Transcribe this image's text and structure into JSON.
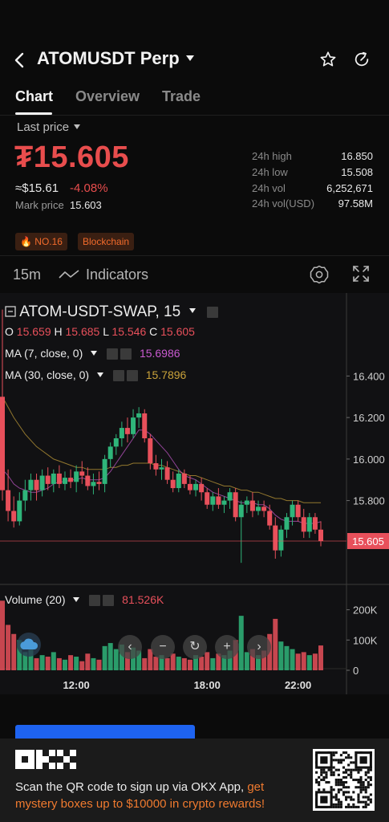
{
  "header": {
    "title": "ATOMUSDT Perp"
  },
  "tabs": [
    {
      "label": "Chart"
    },
    {
      "label": "Overview"
    },
    {
      "label": "Trade"
    }
  ],
  "price_panel": {
    "last_price_label": "Last price",
    "price": "₮15.605",
    "usd_price": "≈$15.61",
    "change_pct": "-4.08%",
    "mark_label": "Mark price",
    "mark_value": "15.603",
    "stats": [
      {
        "label": "24h high",
        "value": "16.850"
      },
      {
        "label": "24h low",
        "value": "15.508"
      },
      {
        "label": "24h vol",
        "value": "6,252,671"
      },
      {
        "label": "24h vol(USD)",
        "value": "97.58M"
      }
    ],
    "tags": [
      "NO.16",
      "Blockchain"
    ]
  },
  "chart_toolbar": {
    "interval": "15m",
    "indicators_label": "Indicators"
  },
  "chart_legend": {
    "symbol": "ATOM-USDT-SWAP, 15",
    "o_label": "O",
    "o_value": "15.659",
    "h_label": "H",
    "h_value": "15.685",
    "l_label": "L",
    "l_value": "15.546",
    "c_label": "C",
    "c_value": "15.605",
    "ma7_label": "MA (7, close, 0)",
    "ma7_value": "15.6986",
    "ma30_label": "MA (30, close, 0)",
    "ma30_value": "15.7896",
    "volume_label": "Volume (20)",
    "volume_value": "81.526K"
  },
  "colors": {
    "up": "#2fb57a",
    "down": "#e8505b",
    "ma7": "#c95ad0",
    "ma30": "#c9a23a",
    "accent_red": "#e84d4d",
    "accent_orange": "#f26b2b"
  },
  "chart_data": {
    "type": "candlestick",
    "current_price": 15.605,
    "price_axis": {
      "ticks": [
        "16.400",
        "16.200",
        "16.000",
        "15.800"
      ],
      "tick_values": [
        16.4,
        16.2,
        16.0,
        15.8
      ],
      "range": [
        15.4,
        16.8
      ]
    },
    "time_axis": {
      "ticks": [
        "12:00",
        "18:00",
        "22:00"
      ]
    },
    "volume_axis": {
      "ticks": [
        "200K",
        "100K",
        "0"
      ],
      "tick_values": [
        200,
        100,
        0
      ],
      "range": [
        0,
        260
      ]
    },
    "candles": [
      [
        16.3,
        16.72,
        15.8,
        15.85
      ],
      [
        15.85,
        15.95,
        15.7,
        15.75
      ],
      [
        15.75,
        15.82,
        15.67,
        15.7
      ],
      [
        15.7,
        15.84,
        15.68,
        15.8
      ],
      [
        15.8,
        15.9,
        15.75,
        15.85
      ],
      [
        15.85,
        15.93,
        15.8,
        15.9
      ],
      [
        15.9,
        15.93,
        15.8,
        15.85
      ],
      [
        15.85,
        15.95,
        15.82,
        15.92
      ],
      [
        15.92,
        15.96,
        15.85,
        15.88
      ],
      [
        15.88,
        15.95,
        15.84,
        15.93
      ],
      [
        15.93,
        15.97,
        15.86,
        15.88
      ],
      [
        15.88,
        15.94,
        15.85,
        15.91
      ],
      [
        15.91,
        15.95,
        15.86,
        15.89
      ],
      [
        15.89,
        15.97,
        15.84,
        15.94
      ],
      [
        15.94,
        15.99,
        15.88,
        15.92
      ],
      [
        15.92,
        15.96,
        15.85,
        15.87
      ],
      [
        15.87,
        15.93,
        15.83,
        15.89
      ],
      [
        15.89,
        15.94,
        15.85,
        15.88
      ],
      [
        15.88,
        16.02,
        15.84,
        16.0
      ],
      [
        16.0,
        16.08,
        15.96,
        16.06
      ],
      [
        16.06,
        16.12,
        16.02,
        16.1
      ],
      [
        16.1,
        16.18,
        16.06,
        16.15
      ],
      [
        16.15,
        16.2,
        16.08,
        16.12
      ],
      [
        16.12,
        16.24,
        16.1,
        16.2
      ],
      [
        16.2,
        16.25,
        16.15,
        16.22
      ],
      [
        16.22,
        16.24,
        16.08,
        16.1
      ],
      [
        16.1,
        16.12,
        15.95,
        15.98
      ],
      [
        15.98,
        16.02,
        15.92,
        15.95
      ],
      [
        15.95,
        16.0,
        15.9,
        15.96
      ],
      [
        15.96,
        15.99,
        15.88,
        15.9
      ],
      [
        15.9,
        15.94,
        15.84,
        15.86
      ],
      [
        15.86,
        15.95,
        15.84,
        15.93
      ],
      [
        15.93,
        15.95,
        15.86,
        15.88
      ],
      [
        15.88,
        15.92,
        15.83,
        15.85
      ],
      [
        15.85,
        15.9,
        15.82,
        15.88
      ],
      [
        15.88,
        15.91,
        15.8,
        15.84
      ],
      [
        15.84,
        15.86,
        15.76,
        15.78
      ],
      [
        15.78,
        15.84,
        15.75,
        15.82
      ],
      [
        15.82,
        15.86,
        15.76,
        15.78
      ],
      [
        15.78,
        15.82,
        15.74,
        15.8
      ],
      [
        15.8,
        15.86,
        15.76,
        15.84
      ],
      [
        15.84,
        15.86,
        15.7,
        15.72
      ],
      [
        15.72,
        15.8,
        15.5,
        15.78
      ],
      [
        15.78,
        15.82,
        15.74,
        15.8
      ],
      [
        15.8,
        15.84,
        15.72,
        15.75
      ],
      [
        15.75,
        15.8,
        15.73,
        15.77
      ],
      [
        15.77,
        15.8,
        15.72,
        15.75
      ],
      [
        15.75,
        15.78,
        15.66,
        15.68
      ],
      [
        15.68,
        15.72,
        15.52,
        15.56
      ],
      [
        15.56,
        15.68,
        15.53,
        15.66
      ],
      [
        15.66,
        15.74,
        15.62,
        15.72
      ],
      [
        15.72,
        15.8,
        15.68,
        15.78
      ],
      [
        15.78,
        15.8,
        15.7,
        15.72
      ],
      [
        15.72,
        15.76,
        15.62,
        15.65
      ],
      [
        15.65,
        15.74,
        15.62,
        15.72
      ],
      [
        15.72,
        15.74,
        15.64,
        15.66
      ],
      [
        15.66,
        15.7,
        15.58,
        15.605
      ]
    ],
    "ma7": [
      15.95,
      15.92,
      15.88,
      15.86,
      15.85,
      15.84,
      15.84,
      15.85,
      15.86,
      15.88,
      15.89,
      15.89,
      15.9,
      15.9,
      15.91,
      15.9,
      15.9,
      15.9,
      15.91,
      15.94,
      15.98,
      16.02,
      16.06,
      16.1,
      16.14,
      16.14,
      16.12,
      16.09,
      16.06,
      16.03,
      15.99,
      15.95,
      15.92,
      15.91,
      15.9,
      15.88,
      15.86,
      15.84,
      15.83,
      15.82,
      15.81,
      15.8,
      15.79,
      15.79,
      15.79,
      15.78,
      15.78,
      15.76,
      15.73,
      15.71,
      15.7,
      15.7,
      15.7,
      15.69,
      15.69,
      15.69,
      15.6986
    ],
    "ma30": [
      16.3,
      16.25,
      16.2,
      16.16,
      16.12,
      16.09,
      16.06,
      16.04,
      16.02,
      16.0,
      15.99,
      15.98,
      15.97,
      15.96,
      15.96,
      15.95,
      15.95,
      15.95,
      15.95,
      15.96,
      15.96,
      15.97,
      15.97,
      15.98,
      15.98,
      15.98,
      15.98,
      15.97,
      15.97,
      15.96,
      15.95,
      15.94,
      15.93,
      15.92,
      15.92,
      15.91,
      15.9,
      15.89,
      15.88,
      15.87,
      15.87,
      15.86,
      15.85,
      15.85,
      15.84,
      15.84,
      15.83,
      15.82,
      15.81,
      15.81,
      15.8,
      15.8,
      15.8,
      15.79,
      15.79,
      15.79,
      15.7896
    ],
    "volume": [
      230,
      150,
      120,
      100,
      60,
      70,
      40,
      50,
      45,
      60,
      40,
      35,
      50,
      45,
      30,
      55,
      40,
      35,
      80,
      90,
      70,
      85,
      60,
      75,
      65,
      40,
      70,
      45,
      50,
      40,
      55,
      45,
      40,
      35,
      50,
      45,
      60,
      40,
      55,
      50,
      65,
      100,
      180,
      60,
      70,
      50,
      65,
      120,
      170,
      95,
      80,
      70,
      55,
      60,
      50,
      55,
      82
    ]
  },
  "banner": {
    "text_main": "Scan the QR code to sign up via OKX App,",
    "text_highlight": "get mystery boxes up to $10000 in crypto rewards!"
  }
}
